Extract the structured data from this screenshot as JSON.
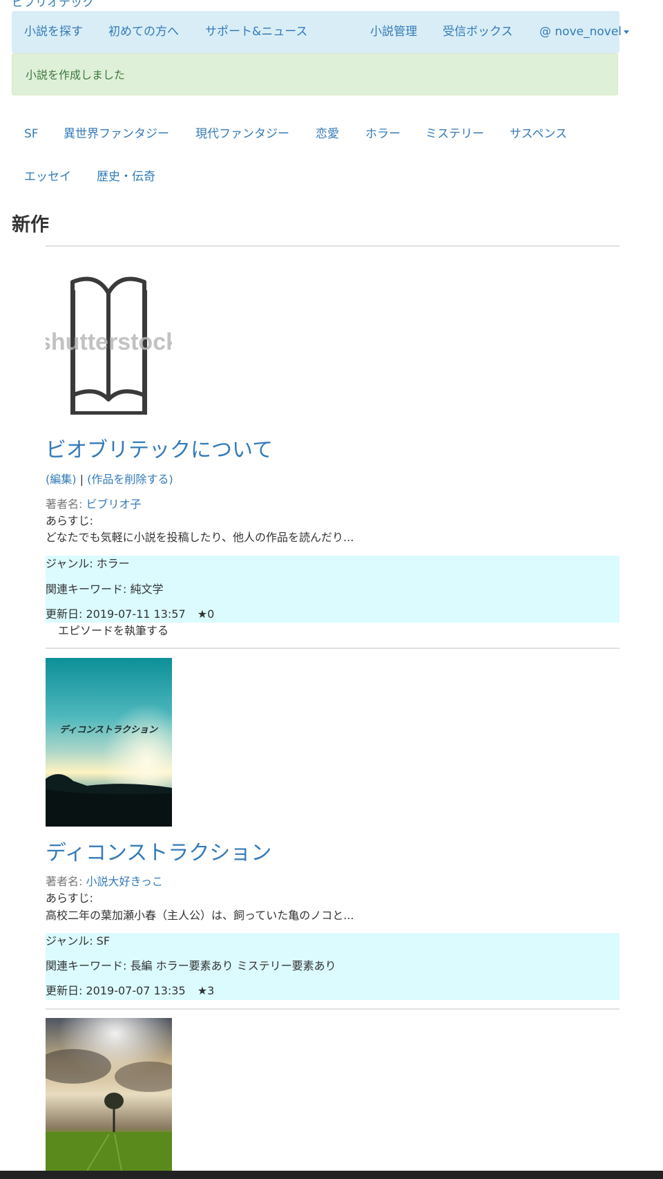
{
  "brand": "ビブリオテック",
  "nav": {
    "search_novels": "小説を探す",
    "beginners": "初めての方へ",
    "support_news": "サポート&ニュース",
    "manage_novels": "小説管理",
    "inbox": "受信ボックス",
    "user_menu": "@ nove_novel"
  },
  "alert": "小説を作成しました",
  "genres": [
    "SF",
    "異世界ファンタジー",
    "現代ファンタジー",
    "恋愛",
    "ホラー",
    "ミステリー",
    "サスペンス",
    "エッセイ",
    "歴史・伝奇"
  ],
  "section_title": "新作",
  "novels": [
    {
      "cover_watermark": "shutterstock",
      "title": "ビオブリテックについて",
      "edit_label": "(編集)",
      "separator": "|",
      "delete_label": "(作品を削除する)",
      "author_label": "著者名:",
      "author": "ビブリオ子",
      "synopsis_label": "あらすじ:",
      "synopsis": "どなたでも気軽に小説を投稿したり、他人の作品を読んだり...",
      "genre_text": "ジャンル: ホラー",
      "keywords_text": "関連キーワード: 純文学",
      "updated_text": "更新日: 2019-07-11 13:57",
      "stars": "★0",
      "write_episode": "エピソードを執筆する"
    },
    {
      "cover_text": "ディコンストラクション",
      "title": "ディコンストラクション",
      "author_label": "著者名:",
      "author": "小説大好きっこ",
      "synopsis_label": "あらすじ:",
      "synopsis": "高校二年の葉加瀬小春（主人公）は、飼っていた亀のノコと...",
      "genre_text": "ジャンル: SF",
      "keywords_text": "関連キーワード: 長編 ホラー要素あり ミステリー要素あり",
      "updated_text": "更新日: 2019-07-07 13:35",
      "stars": "★3"
    }
  ],
  "colors": {
    "link": "#337ab7",
    "navbar_bg": "#d9edf7",
    "alert_bg": "#dff0d8",
    "alert_text": "#3c763d",
    "info_bg": "#dbfbff"
  }
}
